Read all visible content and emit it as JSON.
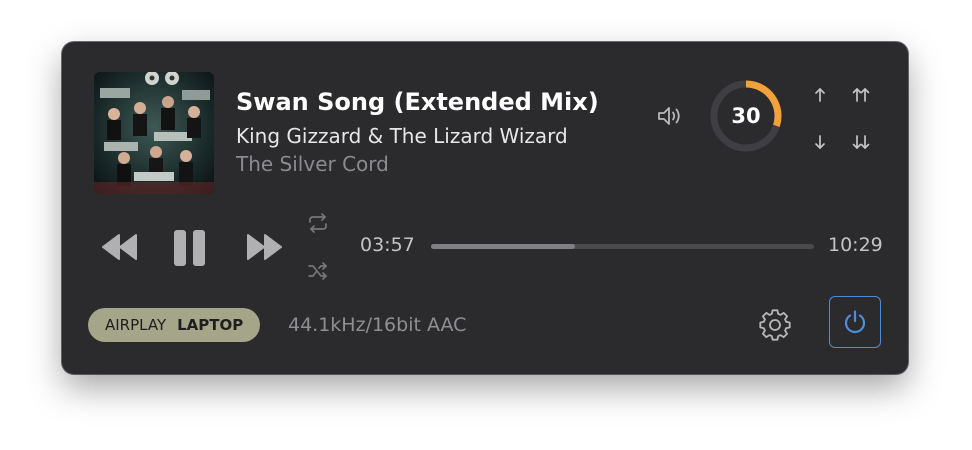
{
  "track": {
    "title": "Swan Song (Extended Mix)",
    "artist": "King Gizzard & The Lizard Wizard",
    "album": "The Silver Cord"
  },
  "volume": {
    "value": "30",
    "level": 0.3,
    "arc_color": "#f2a13b"
  },
  "playback": {
    "elapsed": "03:57",
    "duration": "10:29",
    "progress": 0.377,
    "state": "playing"
  },
  "output": {
    "protocol": "AIRPLAY",
    "device": "LAPTOP",
    "badge_color": "#a5a58a"
  },
  "format": "44.1kHz/16bit AAC",
  "icons": {
    "volume": "speaker-icon",
    "up": "arrow-up-icon",
    "up_double": "double-arrow-up-icon",
    "down": "arrow-down-icon",
    "down_double": "double-arrow-down-icon",
    "repeat": "repeat-icon",
    "shuffle": "shuffle-icon",
    "settings": "gear-icon",
    "power": "power-icon"
  },
  "colors": {
    "panel": "#2b2b2d",
    "power_accent": "#4c8fd6"
  }
}
